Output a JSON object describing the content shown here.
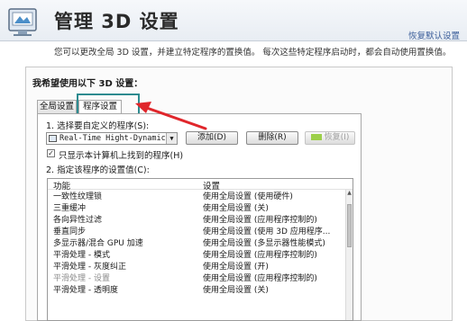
{
  "header": {
    "title": "管理 3D 设置",
    "restore_label": "恢复默认设置"
  },
  "description": "您可以更改全局 3D 设置，并建立特定程序的置换值。 每次这些特定程序启动时，都会自动使用置换值。",
  "section_label": "我希望使用以下 3D 设置：",
  "tabs": [
    {
      "label": "全局设置",
      "active": false
    },
    {
      "label": "程序设置",
      "active": true
    }
  ],
  "step1_label": "1. 选择要自定义的程序(S):",
  "program_select": {
    "value": "Real-Time Hight-Dynamic Ran"
  },
  "buttons": {
    "add_label": "添加(D)",
    "remove_label": "删除(R)",
    "restore_label": "恢复(I)"
  },
  "checkbox": {
    "checked": true,
    "label": "只显示本计算机上找到的程序(H)"
  },
  "step2_label": "2. 指定该程序的设置值(C):",
  "table": {
    "headers": [
      "功能",
      "设置"
    ],
    "rows": [
      {
        "feature": "一致性纹理锁",
        "setting": "使用全局设置 (使用硬件)"
      },
      {
        "feature": "三重缓冲",
        "setting": "使用全局设置 (关)"
      },
      {
        "feature": "各向异性过滤",
        "setting": "使用全局设置 (应用程序控制的)"
      },
      {
        "feature": "垂直同步",
        "setting": "使用全局设置 (使用 3D 应用程序..."
      },
      {
        "feature": "多显示器/混合 GPU 加速",
        "setting": "使用全局设置 (多显示器性能模式)"
      },
      {
        "feature": "平滑处理 - 模式",
        "setting": "使用全局设置 (应用程序控制的)"
      },
      {
        "feature": "平滑处理 - 灰度纠正",
        "setting": "使用全局设置 (开)"
      },
      {
        "feature": "平滑处理 - 设置",
        "setting": "使用全局设置 (应用程序控制的)"
      },
      {
        "feature": "平滑处理 - 透明度",
        "setting": "使用全局设置 (关)"
      }
    ]
  },
  "colors": {
    "highlight": "#2d8b90",
    "arrow": "#e0262b",
    "link": "#3b5e9a"
  }
}
